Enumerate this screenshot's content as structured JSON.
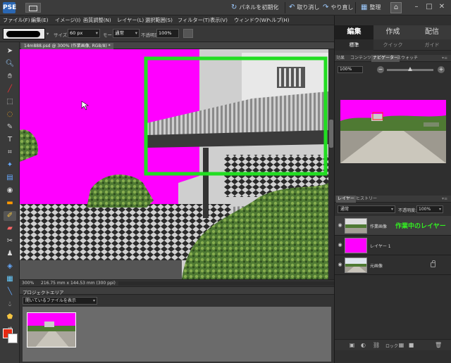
{
  "topbar": {
    "app_badge": "PSE",
    "reset_panels": "パネルを初期化",
    "undo": "取り消し",
    "redo": "やり直し",
    "organize": "整理"
  },
  "menu": [
    "ファイル(F)",
    "編集(E)",
    "イメージ(I)",
    "画質調整(N)",
    "レイヤー(L)",
    "選択範囲(S)",
    "フィルター(T)",
    "表示(V)",
    "ウィンドウ(W)",
    "ヘルプ(H)"
  ],
  "options": {
    "size_label": "サイズ",
    "size_value": "60 px",
    "mode_label": "モード",
    "mode_value": "通常",
    "opacity_label": "不透明度",
    "opacity_value": "100%"
  },
  "document": {
    "tab_label": "14m888.psd @ 300% (作業画像, RGB/8) *",
    "zoom": "300%",
    "info": "216.75 mm x 144.53 mm (300 ppi)"
  },
  "project_bin": {
    "title": "プロジェクトエリア",
    "select_value": "開いているファイルを表示"
  },
  "right_panel": {
    "tabs": [
      "編集",
      "作成",
      "配信"
    ],
    "subtabs": [
      "標準",
      "クイック",
      "ガイド"
    ],
    "nav_tabs": [
      "効果",
      "コンテンツ",
      "ナビゲーター",
      "スウォッチ"
    ],
    "nav_zoom": "100%",
    "layer_tabs": [
      "レイヤー",
      "ヒストリー"
    ],
    "blend_mode": "通常",
    "opacity_label": "不透明度:",
    "opacity_value": "100%",
    "layers": [
      {
        "name": "作業画像",
        "note": "作業中のレイヤー"
      },
      {
        "name": "レイヤー 1",
        "note": ""
      },
      {
        "name": "元画像",
        "note": ""
      }
    ],
    "lock_label": "ロック"
  },
  "colors": {
    "magenta": "#ff00ff",
    "selection_green": "#22dd22",
    "foreground": "#e62a12",
    "background": "#ffffff"
  }
}
